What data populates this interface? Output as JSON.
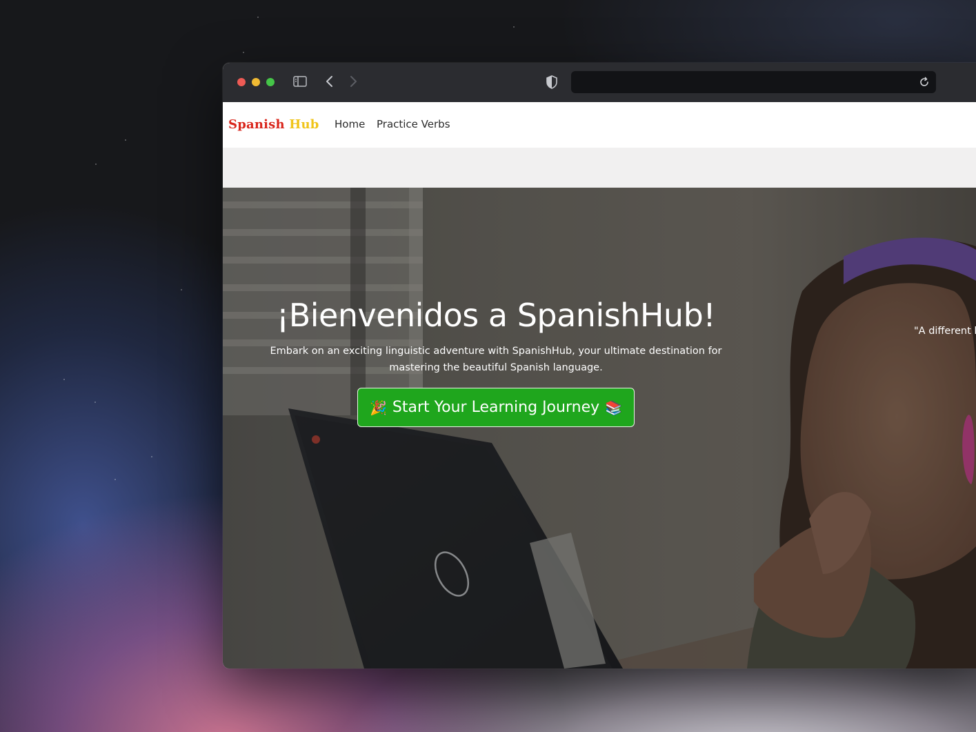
{
  "browser": {
    "colors": {
      "titlebar": "#2b2c30",
      "urlbar": "#121316",
      "close": "#ee5b55",
      "minimize": "#f0ba33",
      "maximize": "#45c548"
    },
    "icons": [
      "sidebar-icon",
      "back-icon",
      "forward-icon",
      "shield-icon",
      "reload-icon"
    ]
  },
  "nav": {
    "brand_part1": "Spanish",
    "brand_part2": "Hub",
    "brand_colors": [
      "#d9261c",
      "#f0c419"
    ],
    "links": [
      {
        "label": "Home"
      },
      {
        "label": "Practice Verbs"
      }
    ]
  },
  "hero": {
    "title": "¡Bienvenidos a SpanishHub!",
    "text": "Embark on an exciting linguistic adventure with SpanishHub, your ultimate destination for mastering the beautiful Spanish language.",
    "cta": {
      "emoji_left": "🎉",
      "label": "Start Your Learning Journey",
      "emoji_right": "📚",
      "color": "#1fa61d"
    },
    "quote": "\"A different l"
  }
}
